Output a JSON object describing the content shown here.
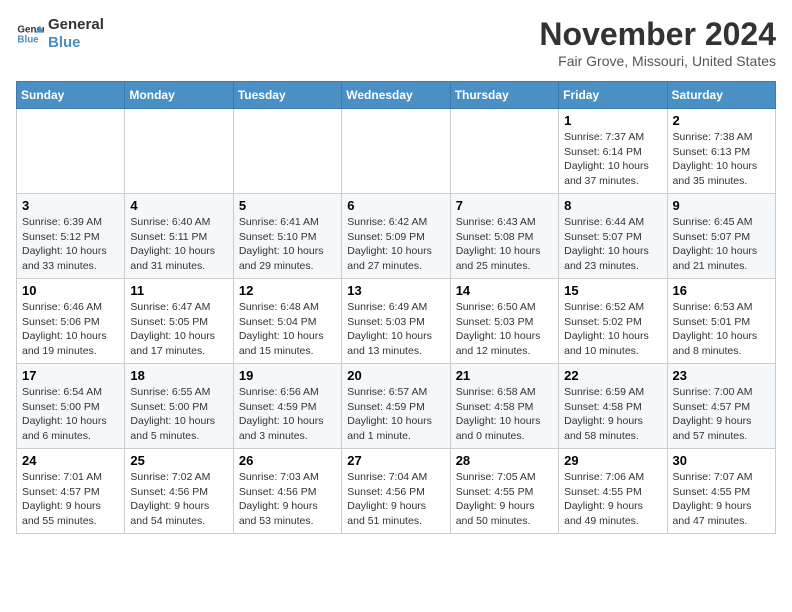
{
  "header": {
    "logo_line1": "General",
    "logo_line2": "Blue",
    "month": "November 2024",
    "location": "Fair Grove, Missouri, United States"
  },
  "weekdays": [
    "Sunday",
    "Monday",
    "Tuesday",
    "Wednesday",
    "Thursday",
    "Friday",
    "Saturday"
  ],
  "weeks": [
    [
      {
        "day": "",
        "info": ""
      },
      {
        "day": "",
        "info": ""
      },
      {
        "day": "",
        "info": ""
      },
      {
        "day": "",
        "info": ""
      },
      {
        "day": "",
        "info": ""
      },
      {
        "day": "1",
        "info": "Sunrise: 7:37 AM\nSunset: 6:14 PM\nDaylight: 10 hours and 37 minutes."
      },
      {
        "day": "2",
        "info": "Sunrise: 7:38 AM\nSunset: 6:13 PM\nDaylight: 10 hours and 35 minutes."
      }
    ],
    [
      {
        "day": "3",
        "info": "Sunrise: 6:39 AM\nSunset: 5:12 PM\nDaylight: 10 hours and 33 minutes."
      },
      {
        "day": "4",
        "info": "Sunrise: 6:40 AM\nSunset: 5:11 PM\nDaylight: 10 hours and 31 minutes."
      },
      {
        "day": "5",
        "info": "Sunrise: 6:41 AM\nSunset: 5:10 PM\nDaylight: 10 hours and 29 minutes."
      },
      {
        "day": "6",
        "info": "Sunrise: 6:42 AM\nSunset: 5:09 PM\nDaylight: 10 hours and 27 minutes."
      },
      {
        "day": "7",
        "info": "Sunrise: 6:43 AM\nSunset: 5:08 PM\nDaylight: 10 hours and 25 minutes."
      },
      {
        "day": "8",
        "info": "Sunrise: 6:44 AM\nSunset: 5:07 PM\nDaylight: 10 hours and 23 minutes."
      },
      {
        "day": "9",
        "info": "Sunrise: 6:45 AM\nSunset: 5:07 PM\nDaylight: 10 hours and 21 minutes."
      }
    ],
    [
      {
        "day": "10",
        "info": "Sunrise: 6:46 AM\nSunset: 5:06 PM\nDaylight: 10 hours and 19 minutes."
      },
      {
        "day": "11",
        "info": "Sunrise: 6:47 AM\nSunset: 5:05 PM\nDaylight: 10 hours and 17 minutes."
      },
      {
        "day": "12",
        "info": "Sunrise: 6:48 AM\nSunset: 5:04 PM\nDaylight: 10 hours and 15 minutes."
      },
      {
        "day": "13",
        "info": "Sunrise: 6:49 AM\nSunset: 5:03 PM\nDaylight: 10 hours and 13 minutes."
      },
      {
        "day": "14",
        "info": "Sunrise: 6:50 AM\nSunset: 5:03 PM\nDaylight: 10 hours and 12 minutes."
      },
      {
        "day": "15",
        "info": "Sunrise: 6:52 AM\nSunset: 5:02 PM\nDaylight: 10 hours and 10 minutes."
      },
      {
        "day": "16",
        "info": "Sunrise: 6:53 AM\nSunset: 5:01 PM\nDaylight: 10 hours and 8 minutes."
      }
    ],
    [
      {
        "day": "17",
        "info": "Sunrise: 6:54 AM\nSunset: 5:00 PM\nDaylight: 10 hours and 6 minutes."
      },
      {
        "day": "18",
        "info": "Sunrise: 6:55 AM\nSunset: 5:00 PM\nDaylight: 10 hours and 5 minutes."
      },
      {
        "day": "19",
        "info": "Sunrise: 6:56 AM\nSunset: 4:59 PM\nDaylight: 10 hours and 3 minutes."
      },
      {
        "day": "20",
        "info": "Sunrise: 6:57 AM\nSunset: 4:59 PM\nDaylight: 10 hours and 1 minute."
      },
      {
        "day": "21",
        "info": "Sunrise: 6:58 AM\nSunset: 4:58 PM\nDaylight: 10 hours and 0 minutes."
      },
      {
        "day": "22",
        "info": "Sunrise: 6:59 AM\nSunset: 4:58 PM\nDaylight: 9 hours and 58 minutes."
      },
      {
        "day": "23",
        "info": "Sunrise: 7:00 AM\nSunset: 4:57 PM\nDaylight: 9 hours and 57 minutes."
      }
    ],
    [
      {
        "day": "24",
        "info": "Sunrise: 7:01 AM\nSunset: 4:57 PM\nDaylight: 9 hours and 55 minutes."
      },
      {
        "day": "25",
        "info": "Sunrise: 7:02 AM\nSunset: 4:56 PM\nDaylight: 9 hours and 54 minutes."
      },
      {
        "day": "26",
        "info": "Sunrise: 7:03 AM\nSunset: 4:56 PM\nDaylight: 9 hours and 53 minutes."
      },
      {
        "day": "27",
        "info": "Sunrise: 7:04 AM\nSunset: 4:56 PM\nDaylight: 9 hours and 51 minutes."
      },
      {
        "day": "28",
        "info": "Sunrise: 7:05 AM\nSunset: 4:55 PM\nDaylight: 9 hours and 50 minutes."
      },
      {
        "day": "29",
        "info": "Sunrise: 7:06 AM\nSunset: 4:55 PM\nDaylight: 9 hours and 49 minutes."
      },
      {
        "day": "30",
        "info": "Sunrise: 7:07 AM\nSunset: 4:55 PM\nDaylight: 9 hours and 47 minutes."
      }
    ]
  ]
}
